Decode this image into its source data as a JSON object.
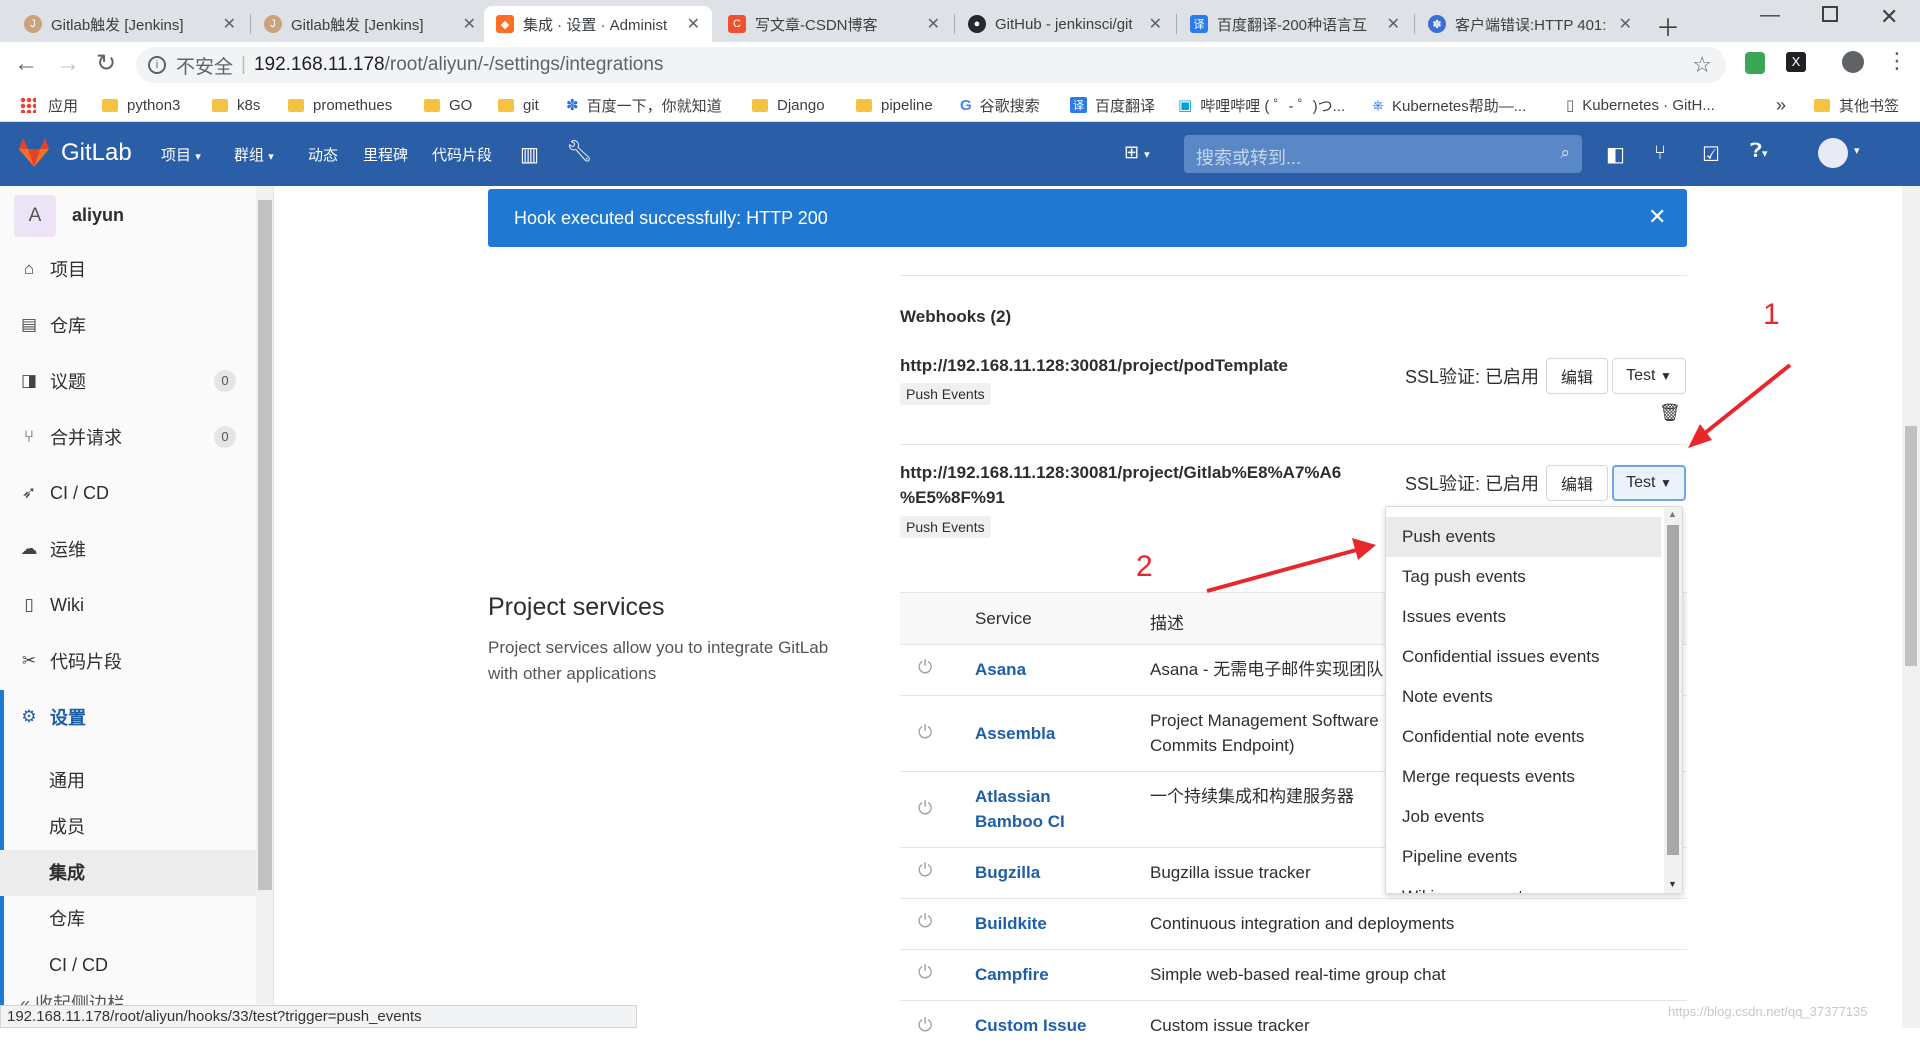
{
  "browser": {
    "tabs": [
      {
        "title": "Gitlab触发 [Jenkins]",
        "active": false
      },
      {
        "title": "Gitlab触发 [Jenkins]",
        "active": false
      },
      {
        "title": "集成 · 设置 · Administ",
        "active": true
      },
      {
        "title": "写文章-CSDN博客",
        "active": false
      },
      {
        "title": "GitHub - jenkinsci/git",
        "active": false
      },
      {
        "title": "百度翻译-200种语言互",
        "active": false
      },
      {
        "title": "客户端错误:HTTP 401:",
        "active": false
      }
    ],
    "security_label": "不安全",
    "url_host": "192.168.11.178",
    "url_path": "/root/aliyun/-/settings/integrations",
    "bookmarks": [
      "应用",
      "python3",
      "k8s",
      "promethues",
      "GO",
      "git",
      "百度一下，你就知道",
      "Django",
      "pipeline",
      "谷歌搜索",
      "百度翻译",
      "哔哩哔哩 ( ゜- ゜)つ...",
      "Kubernetes帮助—...",
      "Kubernetes · GitH..."
    ],
    "more_bookmarks": "»",
    "other_bookmarks": "其他书签",
    "status_url": "192.168.11.178/root/aliyun/hooks/33/test?trigger=push_events"
  },
  "gitlab": {
    "brand": "GitLab",
    "nav": [
      "项目",
      "群组",
      "动态",
      "里程碑",
      "代码片段"
    ],
    "search_placeholder": "搜索或转到..."
  },
  "sidebar": {
    "avatar_letter": "A",
    "project_name": "aliyun",
    "items": [
      {
        "label": "项目",
        "icon": "home-icon"
      },
      {
        "label": "仓库",
        "icon": "doc-icon"
      },
      {
        "label": "议题",
        "icon": "issues-icon",
        "count": "0"
      },
      {
        "label": "合并请求",
        "icon": "merge-icon",
        "count": "0"
      },
      {
        "label": "CI / CD",
        "icon": "rocket-icon"
      },
      {
        "label": "运维",
        "icon": "cloud-icon"
      },
      {
        "label": "Wiki",
        "icon": "book-icon"
      },
      {
        "label": "代码片段",
        "icon": "scissors-icon"
      },
      {
        "label": "设置",
        "icon": "gear-icon"
      }
    ],
    "sub_items": [
      "通用",
      "成员",
      "集成",
      "仓库",
      "CI / CD"
    ],
    "collapse_label": "收起侧边栏"
  },
  "flash": {
    "message": "Hook executed successfully: HTTP 200"
  },
  "webhooks": {
    "title": "Webhooks (2)",
    "hooks": [
      {
        "url": "http://192.168.11.128:30081/project/podTemplate",
        "event": "Push Events",
        "ssl": "SSL验证: 已启用",
        "edit": "编辑",
        "test": "Test"
      },
      {
        "url_line1": "http://192.168.11.128:30081/project/Gitlab%E8%A7%A6",
        "url_line2": "%E5%8F%91",
        "event": "Push Events",
        "ssl": "SSL验证: 已启用",
        "edit": "编辑",
        "test": "Test"
      }
    ]
  },
  "dropdown": {
    "items": [
      "Push events",
      "Tag push events",
      "Issues events",
      "Confidential issues events",
      "Note events",
      "Confidential note events",
      "Merge requests events",
      "Job events",
      "Pipeline events",
      "Wiki page events"
    ]
  },
  "project_services": {
    "title": "Project services",
    "description_line1": "Project services allow you to integrate GitLab",
    "description_line2": "with other applications",
    "col_service": "Service",
    "col_desc": "描述",
    "rows": [
      {
        "name": "Asana",
        "desc": "Asana - 无需电子邮件实现团队"
      },
      {
        "name": "Assembla",
        "desc_line1": "Project Management Software",
        "desc_line2": "Commits Endpoint)"
      },
      {
        "name_line1": "Atlassian",
        "name_line2": "Bamboo CI",
        "desc": "一个持续集成和构建服务器"
      },
      {
        "name": "Bugzilla",
        "desc": "Bugzilla issue tracker"
      },
      {
        "name": "Buildkite",
        "desc": "Continuous integration and deployments"
      },
      {
        "name": "Campfire",
        "desc": "Simple web-based real-time group chat"
      },
      {
        "name": "Custom Issue",
        "desc": "Custom issue tracker"
      }
    ]
  },
  "annotations": {
    "one": "1",
    "two": "2"
  },
  "watermark": "https://blog.csdn.net/qq_37377135",
  "colors": {
    "header": "#2a5fa7",
    "flash": "#1f78d1",
    "link": "#1f5fa9",
    "annotation": "#e8262c"
  }
}
